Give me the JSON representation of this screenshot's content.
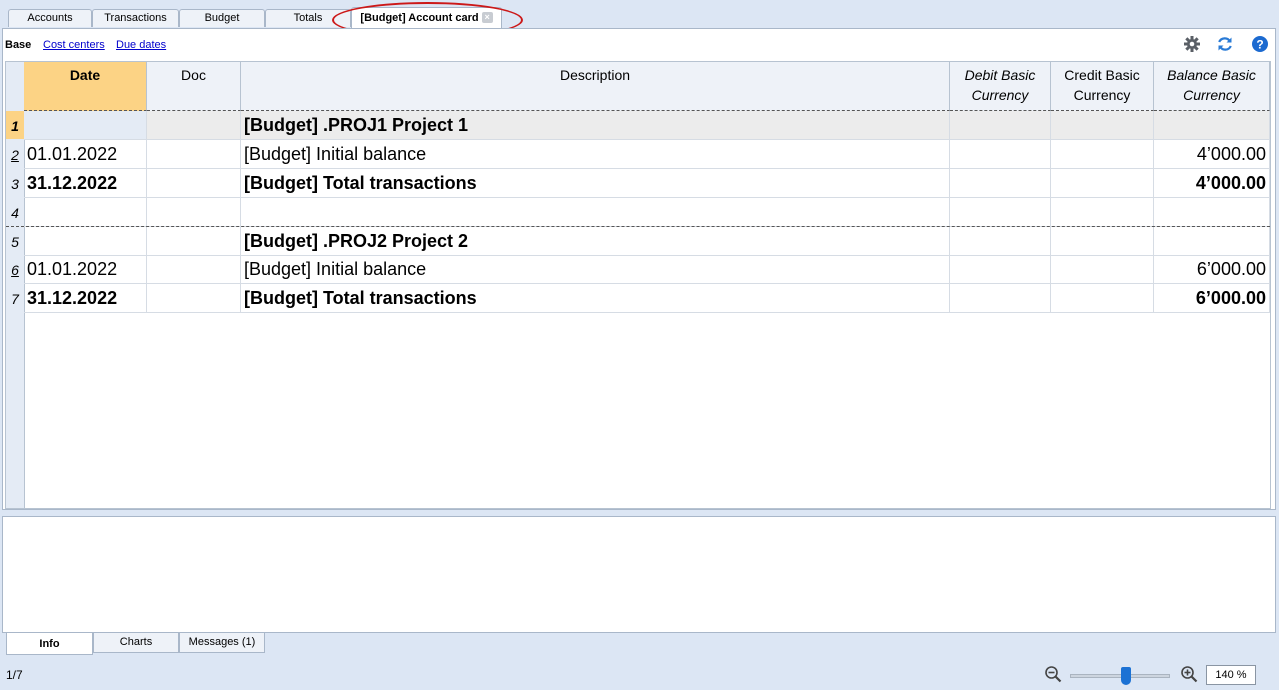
{
  "tabs": [
    "Accounts",
    "Transactions",
    "Budget",
    "Totals",
    "[Budget] Account card"
  ],
  "tab_close_glyph": "×",
  "subnav": [
    "Base",
    "Cost centers",
    "Due dates"
  ],
  "tool_icons": [
    "gear-icon",
    "refresh-icon",
    "help-icon"
  ],
  "columns": {
    "date": "Date",
    "doc": "Doc",
    "description": "Description",
    "debit": [
      "Debit Basic",
      "Currency"
    ],
    "credit": [
      "Credit Basic",
      "Currency"
    ],
    "balance": [
      "Balance Basic",
      "Currency"
    ]
  },
  "rows": [
    {
      "num": "1",
      "date": "",
      "doc": "",
      "description": "[Budget] .PROJ1 Project 1",
      "debit": "",
      "credit": "",
      "balance": ""
    },
    {
      "num": "2",
      "date": "01.01.2022",
      "doc": "",
      "description": "[Budget] Initial balance",
      "debit": "",
      "credit": "",
      "balance": "4’000.00"
    },
    {
      "num": "3",
      "date": "31.12.2022",
      "doc": "",
      "description": "[Budget] Total transactions",
      "debit": "",
      "credit": "",
      "balance": "4’000.00"
    },
    {
      "num": "4",
      "date": "",
      "doc": "",
      "description": "",
      "debit": "",
      "credit": "",
      "balance": ""
    },
    {
      "num": "5",
      "date": "",
      "doc": "",
      "description": "[Budget] .PROJ2 Project 2",
      "debit": "",
      "credit": "",
      "balance": ""
    },
    {
      "num": "6",
      "date": "01.01.2022",
      "doc": "",
      "description": "[Budget] Initial balance",
      "debit": "",
      "credit": "",
      "balance": "6’000.00"
    },
    {
      "num": "7",
      "date": "31.12.2022",
      "doc": "",
      "description": "[Budget] Total transactions",
      "debit": "",
      "credit": "",
      "balance": "6’000.00"
    }
  ],
  "bottom_tabs": [
    "Info",
    "Charts",
    "Messages (1)"
  ],
  "status": {
    "position": "1/7",
    "zoom": "140 %"
  },
  "colors": {
    "highlight": "#fcd385",
    "annotation": "#cc1818",
    "accent": "#1c72d4"
  }
}
